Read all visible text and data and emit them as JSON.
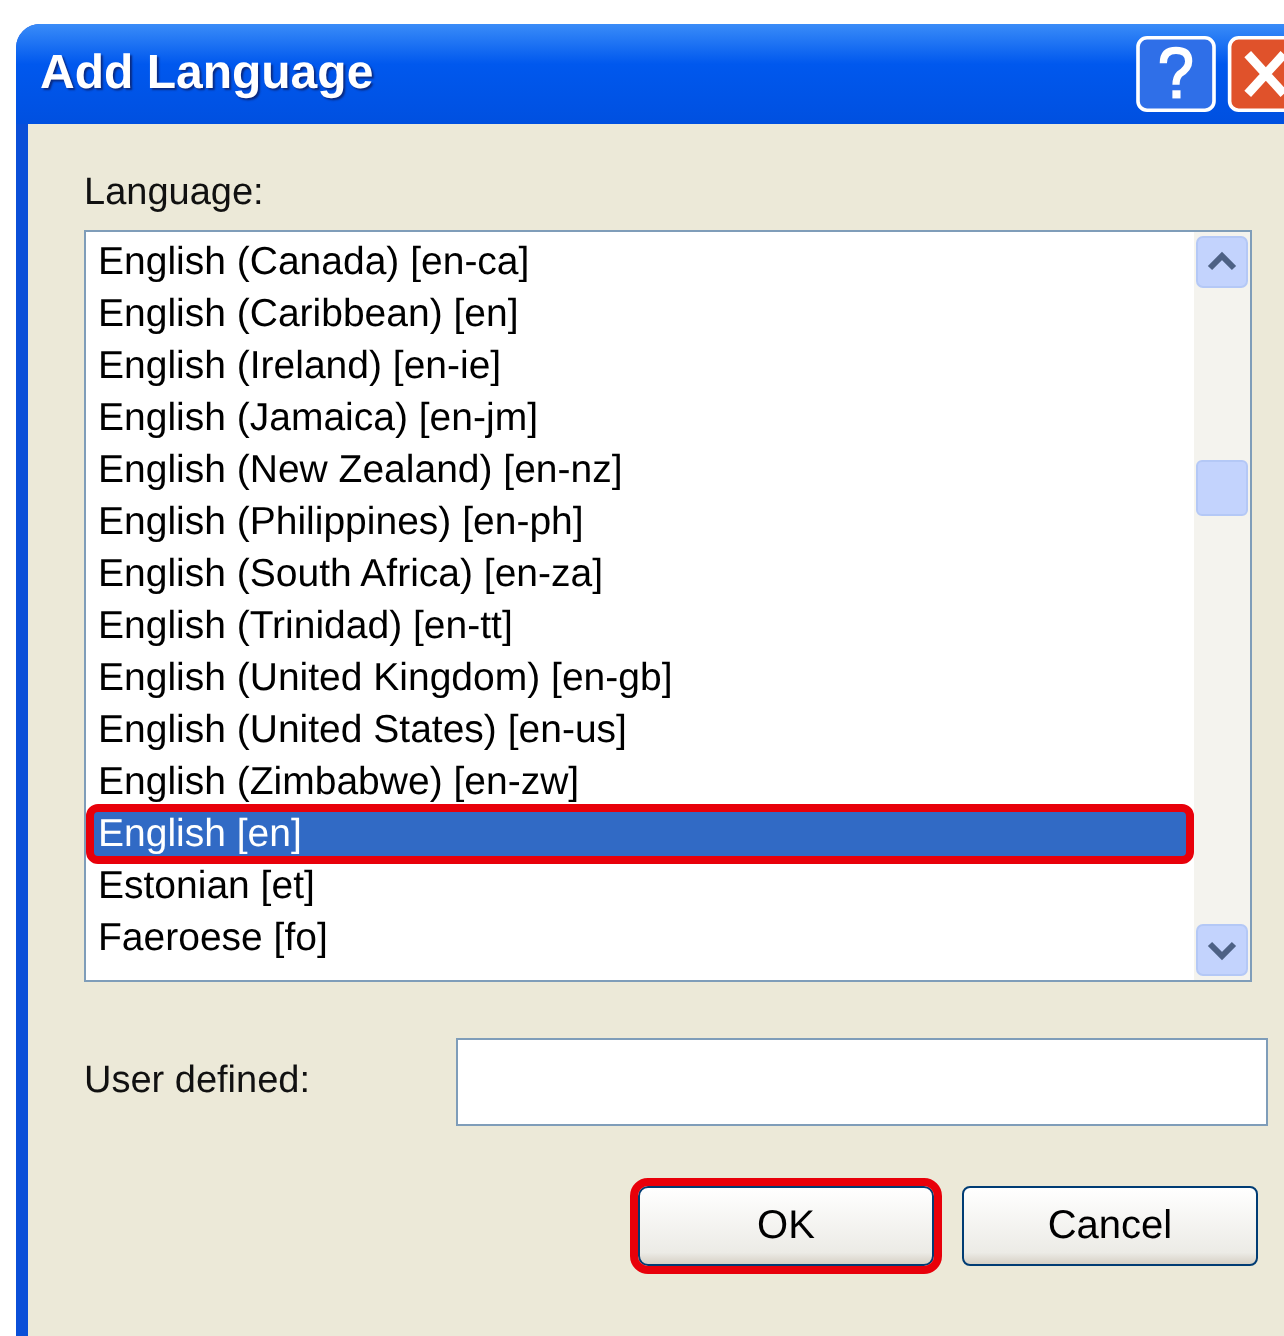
{
  "window": {
    "title": "Add Language"
  },
  "language_list": {
    "label": "Language:",
    "items": [
      {
        "text": "English (Canada) [en-ca]",
        "selected": false,
        "highlighted": false
      },
      {
        "text": "English (Caribbean) [en]",
        "selected": false,
        "highlighted": false
      },
      {
        "text": "English (Ireland) [en-ie]",
        "selected": false,
        "highlighted": false
      },
      {
        "text": "English (Jamaica) [en-jm]",
        "selected": false,
        "highlighted": false
      },
      {
        "text": "English (New Zealand) [en-nz]",
        "selected": false,
        "highlighted": false
      },
      {
        "text": "English (Philippines) [en-ph]",
        "selected": false,
        "highlighted": false
      },
      {
        "text": "English (South Africa) [en-za]",
        "selected": false,
        "highlighted": false
      },
      {
        "text": "English (Trinidad) [en-tt]",
        "selected": false,
        "highlighted": false
      },
      {
        "text": "English (United Kingdom) [en-gb]",
        "selected": false,
        "highlighted": false
      },
      {
        "text": "English (United States) [en-us]",
        "selected": false,
        "highlighted": false
      },
      {
        "text": "English (Zimbabwe) [en-zw]",
        "selected": false,
        "highlighted": false
      },
      {
        "text": "English [en]",
        "selected": true,
        "highlighted": true
      },
      {
        "text": "Estonian [et]",
        "selected": false,
        "highlighted": false
      },
      {
        "text": "Faeroese [fo]",
        "selected": false,
        "highlighted": false
      }
    ]
  },
  "user_defined": {
    "label": "User defined:"
  },
  "buttons": [
    {
      "label": "OK",
      "highlighted": true
    },
    {
      "label": "Cancel",
      "highlighted": false
    }
  ]
}
